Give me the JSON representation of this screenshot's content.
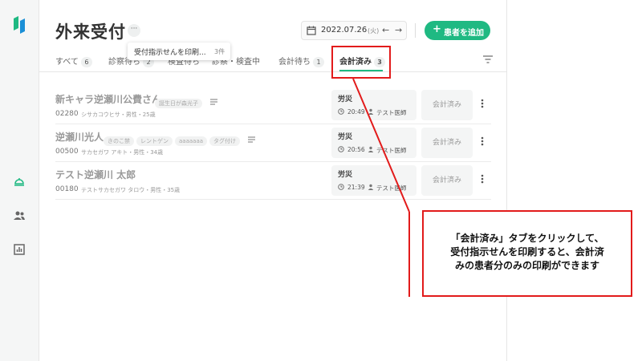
{
  "header": {
    "title": "外来受付",
    "more_label": "···",
    "date": "2022.07.26",
    "day": "(火)",
    "prev_label": "←",
    "next_label": "→",
    "add_patient_label": "患者を追加",
    "add_patient_icon": "+"
  },
  "tooltip": {
    "label": "受付指示せんを印刷...",
    "count": "3件"
  },
  "tabs": [
    {
      "label": "すべて",
      "count": "6"
    },
    {
      "label": "診察待ち",
      "count": "2"
    },
    {
      "label": "検査待ち",
      "count": ""
    },
    {
      "label": "診察・検査中",
      "count": ""
    },
    {
      "label": "会計待ち",
      "count": "1"
    },
    {
      "label": "会計済み",
      "count": "3"
    }
  ],
  "rows": [
    {
      "name": "新キャラ逆瀬川公費さん",
      "tags": [
        "誕生日が森光子"
      ],
      "id": "02280",
      "meta": "シサカコウヒサ・男性・25歳",
      "insurance": "労災",
      "time": "20:49",
      "doctor": "テスト医師",
      "status": "会計済み"
    },
    {
      "name": "逆瀬川光人",
      "tags": [
        "きのこ禁",
        "レントゲン",
        "aaaaaaa",
        "タグ付け"
      ],
      "id": "00500",
      "meta": "サカセガワ アキト・男性・34歳",
      "insurance": "労災",
      "time": "20:56",
      "doctor": "テスト医師",
      "status": "会計済み"
    },
    {
      "name": "テスト逆瀬川 太郎",
      "tags": [],
      "id": "00180",
      "meta": "テストサカセガワ タロウ・男性・35歳",
      "insurance": "労災",
      "time": "21:39",
      "doctor": "テスト医師",
      "status": "会計済み"
    }
  ],
  "callout": {
    "line1": "「会計済み」タブをクリックして、",
    "line2": "受付指示せんを印刷すると、会計済",
    "line3": "みの患者分のみの印刷ができます"
  },
  "colors": {
    "accent": "#1fb982",
    "annotation": "#e21b1b"
  }
}
